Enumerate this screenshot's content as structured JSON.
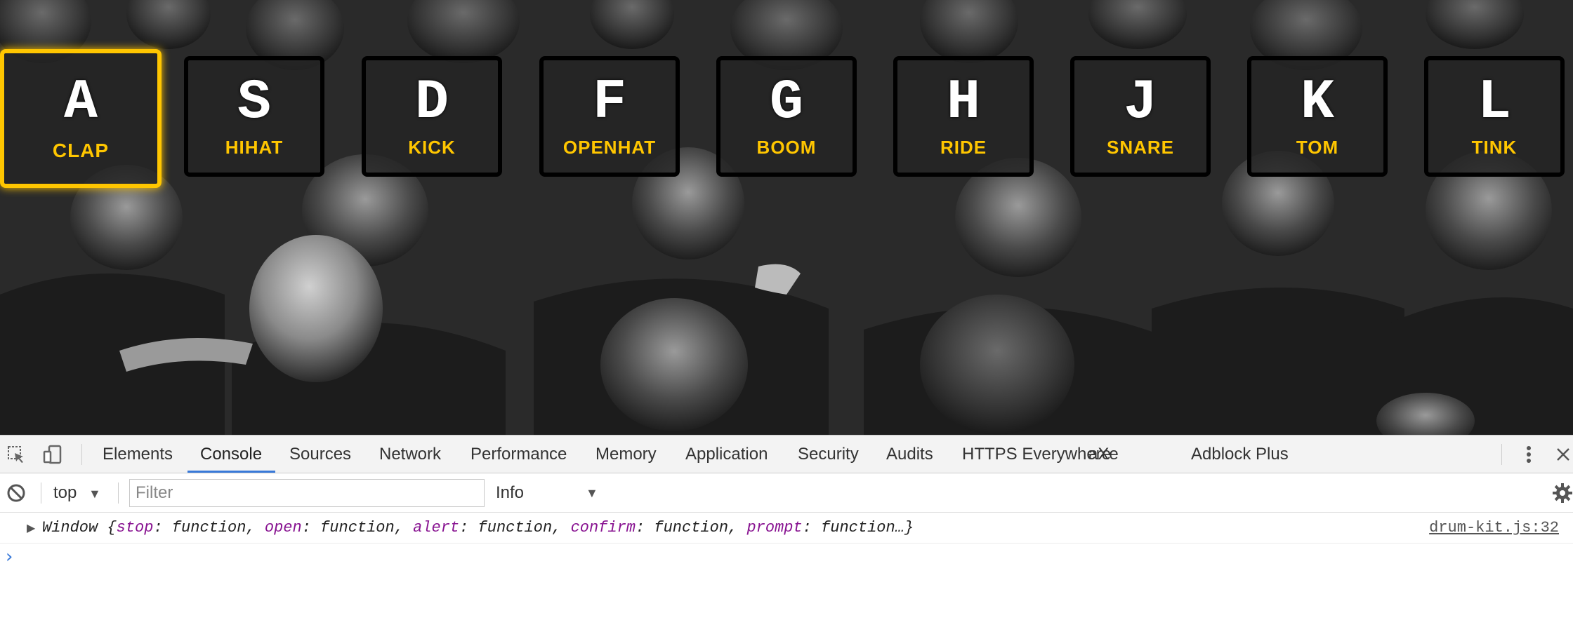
{
  "drumkit": {
    "keys": [
      {
        "key": "A",
        "sound": "clap",
        "active": true
      },
      {
        "key": "S",
        "sound": "hihat"
      },
      {
        "key": "D",
        "sound": "kick"
      },
      {
        "key": "F",
        "sound": "openhat"
      },
      {
        "key": "G",
        "sound": "boom"
      },
      {
        "key": "H",
        "sound": "ride"
      },
      {
        "key": "J",
        "sound": "snare"
      },
      {
        "key": "K",
        "sound": "tom"
      },
      {
        "key": "L",
        "sound": "tink"
      }
    ],
    "accent_color": "#ffc600"
  },
  "devtools": {
    "tabs": [
      {
        "label": "Elements"
      },
      {
        "label": "Console",
        "active": true
      },
      {
        "label": "Sources"
      },
      {
        "label": "Network"
      },
      {
        "label": "Performance"
      },
      {
        "label": "Memory"
      },
      {
        "label": "Application"
      },
      {
        "label": "Security"
      },
      {
        "label": "Audits"
      },
      {
        "label": "HTTPS Everywhere"
      },
      {
        "label": "aXe"
      },
      {
        "label": "Adblock Plus"
      }
    ],
    "toolbar": {
      "context": "top",
      "filter_placeholder": "Filter",
      "level": "Info"
    },
    "console": {
      "message": {
        "prefix": "Window {",
        "props": [
          {
            "name": "stop",
            "value": "function"
          },
          {
            "name": "open",
            "value": "function"
          },
          {
            "name": "alert",
            "value": "function"
          },
          {
            "name": "confirm",
            "value": "function"
          },
          {
            "name": "prompt",
            "value": "function…}"
          }
        ],
        "source": "drum-kit.js:32"
      },
      "prompt_symbol": "›"
    },
    "accent_color": "#3879d9"
  }
}
